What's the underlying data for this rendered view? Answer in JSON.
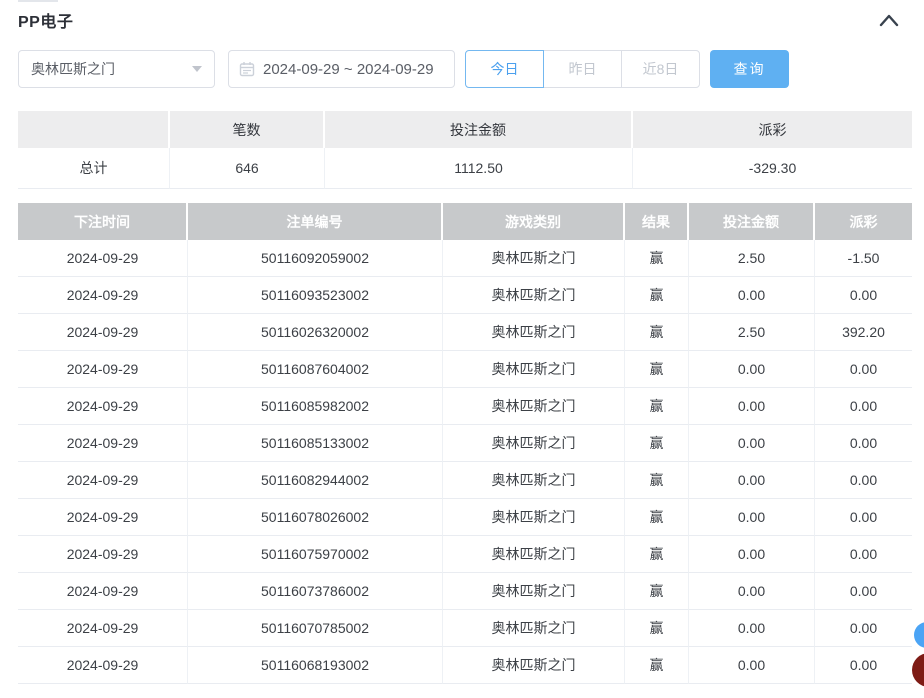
{
  "page": {
    "title": "PP电子"
  },
  "filters": {
    "game_select": {
      "value": "奥林匹斯之门"
    },
    "date_range": {
      "value": "2024-09-29 ~ 2024-09-29"
    },
    "quick_buttons": [
      {
        "label": "今日",
        "active": true
      },
      {
        "label": "昨日",
        "active": false
      },
      {
        "label": "近8日",
        "active": false
      }
    ],
    "search_label": "查询"
  },
  "summary": {
    "headers": [
      "",
      "笔数",
      "投注金额",
      "派彩"
    ],
    "row": {
      "label": "总计",
      "count": "646",
      "bet_amount": "1112.50",
      "payout": "-329.30"
    }
  },
  "table": {
    "headers": [
      "下注时间",
      "注单编号",
      "游戏类别",
      "结果",
      "投注金额",
      "派彩"
    ],
    "rows": [
      [
        "2024-09-29",
        "50116092059002",
        "奥林匹斯之门",
        "赢",
        "2.50",
        "-1.50"
      ],
      [
        "2024-09-29",
        "50116093523002",
        "奥林匹斯之门",
        "赢",
        "0.00",
        "0.00"
      ],
      [
        "2024-09-29",
        "50116026320002",
        "奥林匹斯之门",
        "赢",
        "2.50",
        "392.20"
      ],
      [
        "2024-09-29",
        "50116087604002",
        "奥林匹斯之门",
        "赢",
        "0.00",
        "0.00"
      ],
      [
        "2024-09-29",
        "50116085982002",
        "奥林匹斯之门",
        "赢",
        "0.00",
        "0.00"
      ],
      [
        "2024-09-29",
        "50116085133002",
        "奥林匹斯之门",
        "赢",
        "0.00",
        "0.00"
      ],
      [
        "2024-09-29",
        "50116082944002",
        "奥林匹斯之门",
        "赢",
        "0.00",
        "0.00"
      ],
      [
        "2024-09-29",
        "50116078026002",
        "奥林匹斯之门",
        "赢",
        "0.00",
        "0.00"
      ],
      [
        "2024-09-29",
        "50116075970002",
        "奥林匹斯之门",
        "赢",
        "0.00",
        "0.00"
      ],
      [
        "2024-09-29",
        "50116073786002",
        "奥林匹斯之门",
        "赢",
        "0.00",
        "0.00"
      ],
      [
        "2024-09-29",
        "50116070785002",
        "奥林匹斯之门",
        "赢",
        "0.00",
        "0.00"
      ],
      [
        "2024-09-29",
        "50116068193002",
        "奥林匹斯之门",
        "赢",
        "0.00",
        "0.00"
      ]
    ]
  },
  "colors": {
    "accent_blue": "#5fb0f2",
    "active_tab_blue": "#4ba0ee",
    "negative_red": "#f0575d",
    "table_header_gray": "#c7c9cb",
    "summary_header_gray": "#ededee",
    "fab_blue": "#4ba4f5",
    "fab_dark_red": "#7e1b15"
  }
}
